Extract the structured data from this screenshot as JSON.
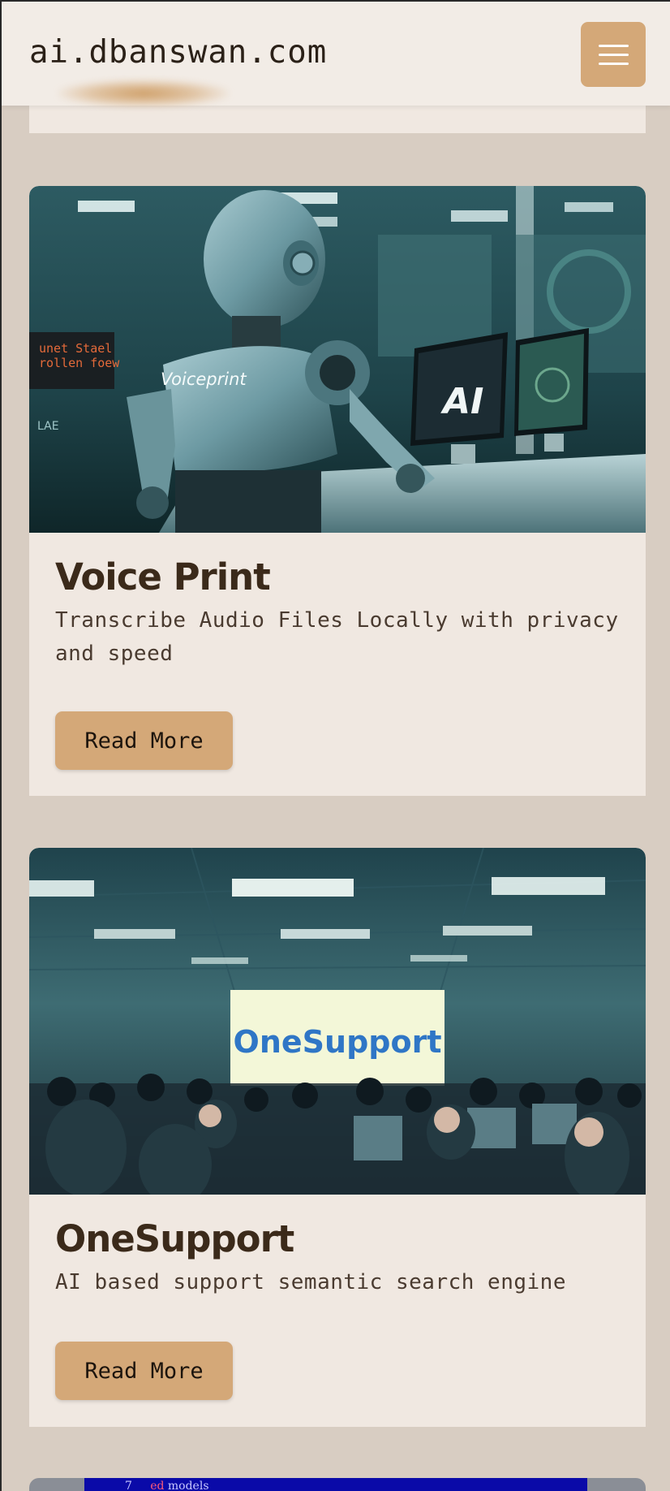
{
  "header": {
    "brand": "ai.dbanswan.com",
    "menu_icon": "hamburger-menu-icon"
  },
  "cards": [
    {
      "title": "Voice Print",
      "description": "Transcribe Audio Files Locally with privacy and speed",
      "button_label": "Read More",
      "image": {
        "robot_label": "Voiceprint",
        "screen_label": "AI",
        "ticker_line1": "unet Stael",
        "ticker_line2": "rollen foew",
        "sign": "LAE"
      }
    },
    {
      "title": "OneSupport",
      "description": "AI based support semantic search engine",
      "button_label": "Read More",
      "image": {
        "screen_label": "OneSupport"
      }
    }
  ],
  "peek_card": {
    "code_line_number": "7",
    "code_keyword": "ed",
    "code_text": "models"
  },
  "colors": {
    "background": "#d8cdc2",
    "card": "#f0e8e1",
    "accent": "#d4a878",
    "title": "#3b2a1a"
  }
}
